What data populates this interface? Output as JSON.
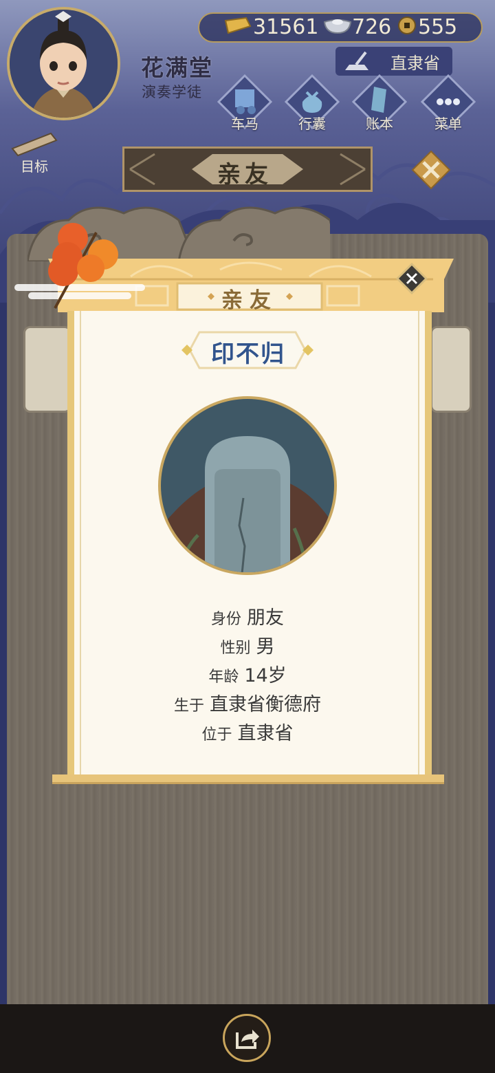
{
  "player": {
    "name": "花满堂",
    "title": "演奏学徒"
  },
  "currency": {
    "gold": "31561",
    "silver": "726",
    "coins": "555"
  },
  "region": "直隶省",
  "nav": [
    {
      "id": "carriage",
      "label": "车马",
      "icon": "carriage-icon"
    },
    {
      "id": "bag",
      "label": "行囊",
      "icon": "bag-icon"
    },
    {
      "id": "ledger",
      "label": "账本",
      "icon": "ledger-icon"
    },
    {
      "id": "menu",
      "label": "菜单",
      "icon": "more-icon"
    }
  ],
  "goal_label": "目标",
  "header_title": "亲友",
  "modal": {
    "title": "亲友",
    "npc_name": "印不归",
    "portrait": "gravestone-icon",
    "rows": [
      {
        "label": "身份",
        "value": "朋友"
      },
      {
        "label": "性别",
        "value": "男"
      },
      {
        "label": "年龄",
        "value": "14岁"
      },
      {
        "label": "生于",
        "value": "直隶省衡德府"
      },
      {
        "label": "位于",
        "value": "直隶省"
      }
    ]
  },
  "colors": {
    "accent_gold": "#c9a55c",
    "name_blue": "#31548d",
    "panel_cream": "#fcf8ee",
    "night_blue": "#353b70"
  }
}
